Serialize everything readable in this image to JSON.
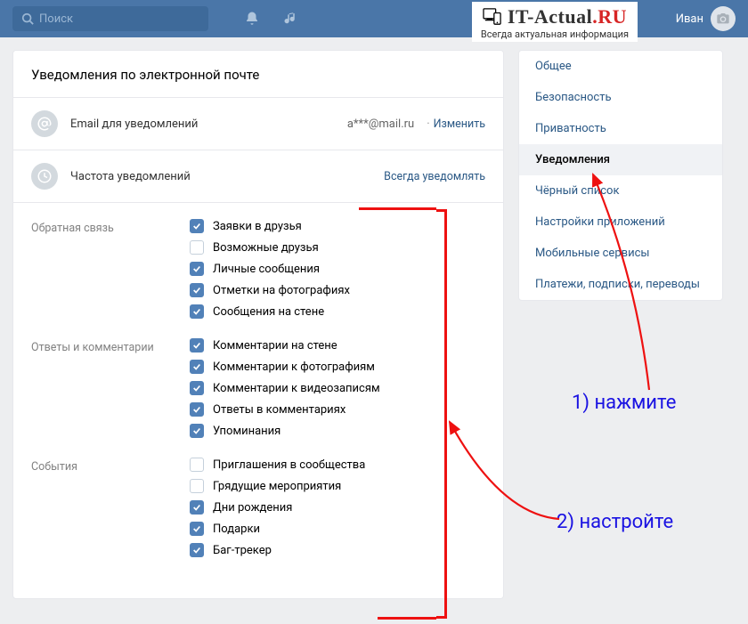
{
  "topbar": {
    "search_placeholder": "Поиск",
    "user_name": "Иван"
  },
  "watermark": {
    "title_pre": "IT-Actual",
    "title_suf": ".RU",
    "subtitle": "Всегда актуальная информация"
  },
  "page": {
    "title": "Уведомления по электронной почте",
    "email_row_label": "Email для уведомлений",
    "email_value": "a***@mail.ru",
    "email_change": "Изменить",
    "freq_row_label": "Частота уведомлений",
    "freq_action": "Всегда уведомлять"
  },
  "groups": [
    {
      "label": "Обратная связь",
      "options": [
        {
          "label": "Заявки в друзья",
          "checked": true
        },
        {
          "label": "Возможные друзья",
          "checked": false
        },
        {
          "label": "Личные сообщения",
          "checked": true
        },
        {
          "label": "Отметки на фотографиях",
          "checked": true
        },
        {
          "label": "Сообщения на стене",
          "checked": true
        }
      ]
    },
    {
      "label": "Ответы и комментарии",
      "options": [
        {
          "label": "Комментарии на стене",
          "checked": true
        },
        {
          "label": "Комментарии к фотографиям",
          "checked": true
        },
        {
          "label": "Комментарии к видеозаписям",
          "checked": true
        },
        {
          "label": "Ответы в комментариях",
          "checked": true
        },
        {
          "label": "Упоминания",
          "checked": true
        }
      ]
    },
    {
      "label": "События",
      "options": [
        {
          "label": "Приглашения в сообщества",
          "checked": false
        },
        {
          "label": "Грядущие мероприятия",
          "checked": false
        },
        {
          "label": "Дни рождения",
          "checked": true
        },
        {
          "label": "Подарки",
          "checked": true
        },
        {
          "label": "Баг-трекер",
          "checked": true
        }
      ]
    }
  ],
  "sidebar": {
    "items": [
      {
        "label": "Общее"
      },
      {
        "label": "Безопасность"
      },
      {
        "label": "Приватность"
      },
      {
        "label": "Уведомления",
        "active": true
      },
      {
        "label": "Чёрный список"
      },
      {
        "label": "Настройки приложений"
      },
      {
        "label": "Мобильные сервисы"
      },
      {
        "label": "Платежи, подписки, переводы"
      }
    ]
  },
  "annotations": {
    "step1": "1) нажмите",
    "step2": "2) настройте"
  }
}
